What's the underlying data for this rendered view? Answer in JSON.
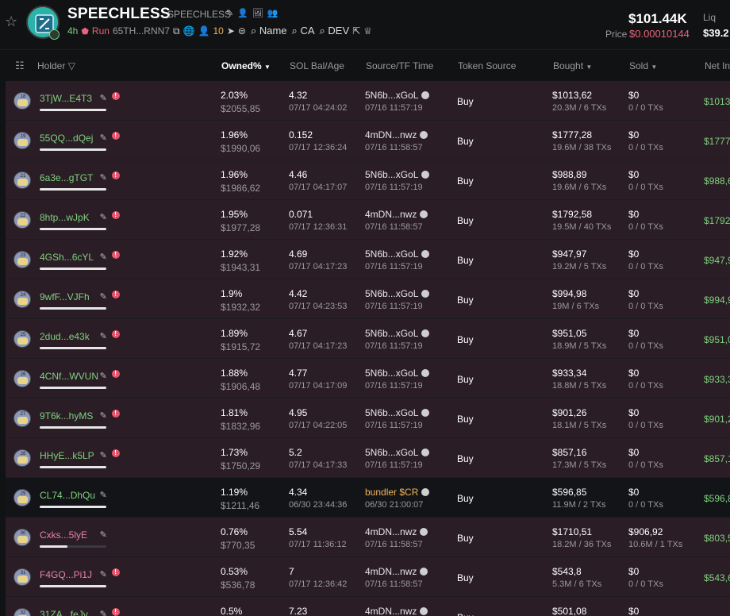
{
  "header": {
    "title": "SPEECHLESS",
    "ticker": "SPEECHLESS",
    "age": "4h",
    "run_label": "Run",
    "contract": "65TH...RNN7",
    "holders_count": "10",
    "search_name": "Name",
    "search_ca": "CA",
    "search_dev": "DEV",
    "market_cap": "$101.44K",
    "liq_label": "Liq",
    "liq_value": "$39.2",
    "price_label": "Price",
    "price_value": "$0.00010144",
    "colors": {
      "price": "#e8647a",
      "accent_green": "#7fd17f"
    }
  },
  "columns": {
    "holder": "Holder",
    "owned": "Owned%",
    "sol": "SOL Bal/Age",
    "source": "Source/TF Time",
    "token_source": "Token Source",
    "bought": "Bought",
    "sold": "Sold",
    "net": "Net In"
  },
  "rows": [
    {
      "rank": "18",
      "holder": "3TjW...E4T3",
      "alert": "!",
      "owned": "2.03%",
      "owned_usd": "$2055,85",
      "sol": "4.32",
      "age": "07/17 04:24:02",
      "source": "5N6b...xGoL",
      "tf": "07/16 11:57:19",
      "tsrc": "Buy",
      "bought": "$1013,62",
      "bought_tx": "20.3M / 6 TXs",
      "sold": "$0",
      "sold_tx": "0 / 0 TXs",
      "net": "$1013",
      "bar": 1.0
    },
    {
      "rank": "19",
      "holder": "55QQ...dQej",
      "alert": "!",
      "owned": "1.96%",
      "owned_usd": "$1990,06",
      "sol": "0.152",
      "age": "07/17 12:36:24",
      "source": "4mDN...nwz",
      "tf": "07/16 11:58:57",
      "tsrc": "Buy",
      "bought": "$1777,28",
      "bought_tx": "19.6M / 38 TXs",
      "sold": "$0",
      "sold_tx": "0 / 0 TXs",
      "net": "$1777",
      "bar": 1.0
    },
    {
      "rank": "21",
      "holder": "6a3e...gTGT",
      "alert": "!",
      "owned": "1.96%",
      "owned_usd": "$1986,62",
      "sol": "4.46",
      "age": "07/17 04:17:07",
      "source": "5N6b...xGoL",
      "tf": "07/16 11:57:19",
      "tsrc": "Buy",
      "bought": "$988,89",
      "bought_tx": "19.6M / 6 TXs",
      "sold": "$0",
      "sold_tx": "0 / 0 TXs",
      "net": "$988,6",
      "bar": 1.0
    },
    {
      "rank": "22",
      "holder": "8htp...wJpK",
      "alert": "!",
      "owned": "1.95%",
      "owned_usd": "$1977,28",
      "sol": "0.071",
      "age": "07/17 12:36:31",
      "source": "4mDN...nwz",
      "tf": "07/16 11:58:57",
      "tsrc": "Buy",
      "bought": "$1792,58",
      "bought_tx": "19.5M / 40 TXs",
      "sold": "$0",
      "sold_tx": "0 / 0 TXs",
      "net": "$1792",
      "bar": 1.0
    },
    {
      "rank": "23",
      "holder": "4GSh...6cYL",
      "alert": "!",
      "owned": "1.92%",
      "owned_usd": "$1943,31",
      "sol": "4.69",
      "age": "07/17 04:17:23",
      "source": "5N6b...xGoL",
      "tf": "07/16 11:57:19",
      "tsrc": "Buy",
      "bought": "$947,97",
      "bought_tx": "19.2M / 5 TXs",
      "sold": "$0",
      "sold_tx": "0 / 0 TXs",
      "net": "$947,9",
      "bar": 1.0
    },
    {
      "rank": "24",
      "holder": "9wfF...VJFh",
      "alert": "!",
      "owned": "1.9%",
      "owned_usd": "$1932,32",
      "sol": "4.42",
      "age": "07/17 04:23:53",
      "source": "5N6b...xGoL",
      "tf": "07/16 11:57:19",
      "tsrc": "Buy",
      "bought": "$994,98",
      "bought_tx": "19M / 6 TXs",
      "sold": "$0",
      "sold_tx": "0 / 0 TXs",
      "net": "$994,9",
      "bar": 1.0
    },
    {
      "rank": "25",
      "holder": "2dud...e43k",
      "alert": "!",
      "owned": "1.89%",
      "owned_usd": "$1915,72",
      "sol": "4.67",
      "age": "07/17 04:17:23",
      "source": "5N6b...xGoL",
      "tf": "07/16 11:57:19",
      "tsrc": "Buy",
      "bought": "$951,05",
      "bought_tx": "18.9M / 5 TXs",
      "sold": "$0",
      "sold_tx": "0 / 0 TXs",
      "net": "$951,0",
      "bar": 1.0
    },
    {
      "rank": "26",
      "holder": "4CNf...WVUN",
      "alert": "!",
      "owned": "1.88%",
      "owned_usd": "$1906,48",
      "sol": "4.77",
      "age": "07/17 04:17:09",
      "source": "5N6b...xGoL",
      "tf": "07/16 11:57:19",
      "tsrc": "Buy",
      "bought": "$933,34",
      "bought_tx": "18.8M / 5 TXs",
      "sold": "$0",
      "sold_tx": "0 / 0 TXs",
      "net": "$933,3",
      "bar": 1.0
    },
    {
      "rank": "27",
      "holder": "9T6k...hyMS",
      "alert": "!",
      "owned": "1.81%",
      "owned_usd": "$1832,96",
      "sol": "4.95",
      "age": "07/17 04:22:05",
      "source": "5N6b...xGoL",
      "tf": "07/16 11:57:19",
      "tsrc": "Buy",
      "bought": "$901,26",
      "bought_tx": "18.1M / 5 TXs",
      "sold": "$0",
      "sold_tx": "0 / 0 TXs",
      "net": "$901,2",
      "bar": 1.0
    },
    {
      "rank": "28",
      "holder": "HHyE...k5LP",
      "alert": "!",
      "owned": "1.73%",
      "owned_usd": "$1750,29",
      "sol": "5.2",
      "age": "07/17 04:17:33",
      "source": "5N6b...xGoL",
      "tf": "07/16 11:57:19",
      "tsrc": "Buy",
      "bought": "$857,16",
      "bought_tx": "17.3M / 5 TXs",
      "sold": "$0",
      "sold_tx": "0 / 0 TXs",
      "net": "$857,1",
      "bar": 1.0
    },
    {
      "rank": "29",
      "holder": "CL74...DhQu",
      "alert": "",
      "owned": "1.19%",
      "owned_usd": "$1211,46",
      "sol": "4.34",
      "age": "06/30 23:44:36",
      "source": "bundler $CR",
      "tf": "06/30 21:00:07",
      "tsrc": "Buy",
      "bought": "$596,85",
      "bought_tx": "11.9M / 2 TXs",
      "sold": "$0",
      "sold_tx": "0 / 0 TXs",
      "net": "$596,8",
      "bar": 1.0
    },
    {
      "rank": "30",
      "holder": "Cxks...5lyE",
      "alert": "",
      "owned": "0.76%",
      "owned_usd": "$770,35",
      "sol": "5.54",
      "age": "07/17 11:36:12",
      "source": "4mDN...nwz",
      "tf": "07/16 11:58:57",
      "tsrc": "Buy",
      "bought": "$1710,51",
      "bought_tx": "18.2M / 36 TXs",
      "sold": "$906,92",
      "sold_tx": "10.6M / 1 TXs",
      "net": "$803,5",
      "bar": 0.42
    },
    {
      "rank": "31",
      "holder": "F4GQ...Pi1J",
      "alert": "!",
      "owned": "0.53%",
      "owned_usd": "$536,78",
      "sol": "7",
      "age": "07/17 12:36:42",
      "source": "4mDN...nwz",
      "tf": "07/16 11:58:57",
      "tsrc": "Buy",
      "bought": "$543,8",
      "bought_tx": "5.3M / 6 TXs",
      "sold": "$0",
      "sold_tx": "0 / 0 TXs",
      "net": "$543,6",
      "bar": 1.0
    },
    {
      "rank": "32",
      "holder": "31ZA...feJv",
      "alert": "!",
      "owned": "0.5%",
      "owned_usd": "",
      "sol": "7.23",
      "age": "",
      "source": "4mDN...nwz",
      "tf": "",
      "tsrc": "Buy",
      "bought": "$501,08",
      "bought_tx": "",
      "sold": "$0",
      "sold_tx": "",
      "net": "",
      "bar": 1.0
    }
  ]
}
